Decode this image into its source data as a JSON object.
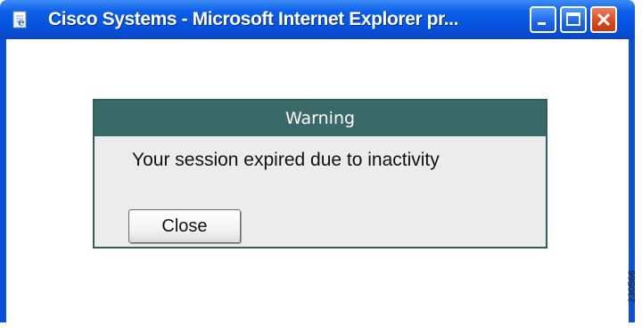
{
  "window": {
    "title": "Cisco Systems - Microsoft Internet Explorer pr...",
    "icon": "ie-page-icon",
    "controls": [
      "minimize-icon",
      "maximize-icon",
      "close-icon"
    ],
    "colors": {
      "titlebar": "#0551de",
      "close": "#d8481f"
    }
  },
  "dialog": {
    "header": "Warning",
    "message": "Your session expired due to inactivity",
    "close_label": "Close",
    "colors": {
      "header": "#3a6a67",
      "body": "#ececec"
    }
  },
  "figure_id": "230566"
}
